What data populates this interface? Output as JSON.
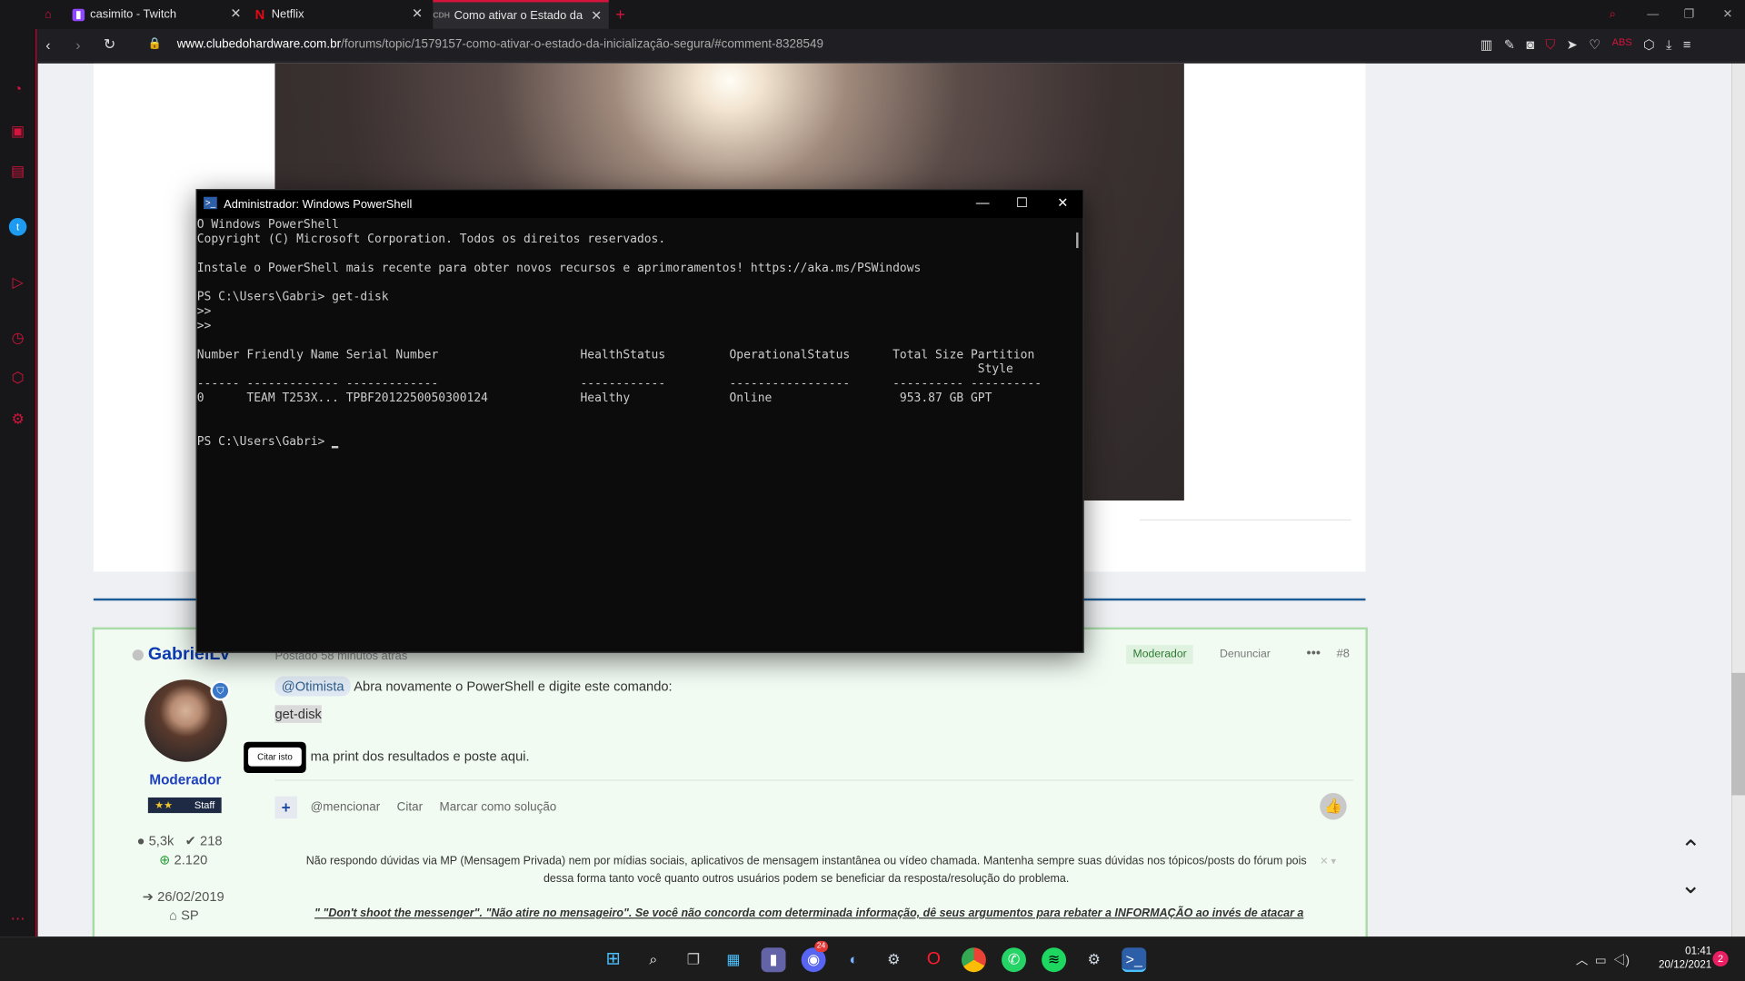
{
  "tabs": [
    {
      "label": "casimito - Twitch",
      "fav": "twitch-icon",
      "color": "#9146ff"
    },
    {
      "label": "Netflix",
      "fav": "netflix-icon",
      "color": "#e50914"
    },
    {
      "label": "Como ativar o Estado da in",
      "fav": "clube-hardware-icon",
      "color": "#888"
    }
  ],
  "address": {
    "domain": "www.clubedohardware.com.br",
    "path": "/forums/topic/1579157-como-ativar-o-estado-da-inicialização-segura/#comment-8328549"
  },
  "powershell": {
    "title": "Administrador: Windows PowerShell",
    "lines": [
      "O Windows PowerShell",
      "Copyright (C) Microsoft Corporation. Todos os direitos reservados.",
      "",
      "Instale o PowerShell mais recente para obter novos recursos e aprimoramentos! https://aka.ms/PSWindows",
      "",
      "PS C:\\Users\\Gabri> get-disk",
      ">>",
      ">>",
      "",
      "Number Friendly Name Serial Number                    HealthStatus         OperationalStatus      Total Size Partition",
      "                                                                                                              Style",
      "------ ------------- -------------                    ------------         -----------------      ---------- ----------",
      "0      TEAM T253X... TPBF2012250050300124             Healthy              Online                  953.87 GB GPT",
      "",
      "",
      "PS C:\\Users\\Gabri> "
    ]
  },
  "post": {
    "author": "GabrielLV",
    "time": "Postado 58 minutos atrás",
    "role": "Moderador",
    "rank": "Staff",
    "badge_stars": "★★",
    "posts": "5,3k",
    "solutions": "218",
    "reputation": "2.120",
    "joined": "26/02/2019",
    "location": "SP",
    "tag_moderator": "Moderador",
    "report": "Denunciar",
    "number": "#8",
    "mention": "@Otimista",
    "text1": "Abra novamente o PowerShell e digite este comando:",
    "code": "get-disk",
    "text2": "ma print dos resultados e poste aqui.",
    "tooltip": "Citar isto",
    "actions": {
      "mention": "@mencionar",
      "quote": "Citar",
      "solution": "Marcar como solução"
    },
    "signature1": "Não respondo dúvidas via MP (Mensagem Privada) nem por mídias sociais, aplicativos de mensagem instantânea ou vídeo chamada. Mantenha sempre suas dúvidas nos tópicos/posts do fórum pois",
    "signature2": "dessa forma tanto você quanto outros usuários podem se beneficiar da resposta/resolução do problema.",
    "signature3": "\" \"Don't shoot the messenger\". \"Não atire no mensageiro\". Se você não concorda com determinada informação, dê seus argumentos para rebater a INFORMAÇÃO ao invés de atacar a"
  },
  "tray": {
    "time": "01:41",
    "date": "20/12/2021",
    "notif": "2",
    "discord_badge": "24"
  }
}
